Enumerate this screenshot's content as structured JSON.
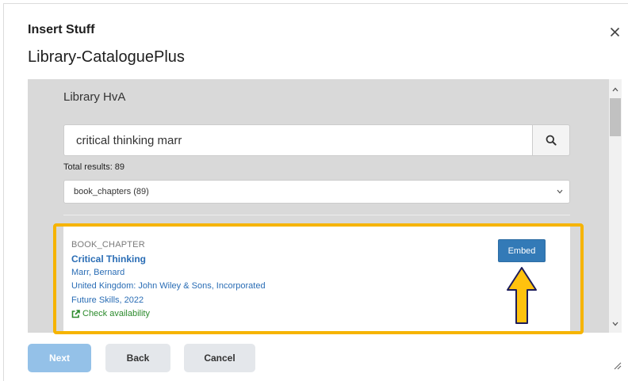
{
  "dialog": {
    "title": "Insert Stuff",
    "subtitle": "Library-CataloguePlus",
    "close_icon": "close-icon",
    "resize_icon": "resize-handle-icon"
  },
  "library": {
    "name": "Library HvA"
  },
  "search": {
    "value": "critical thinking marr",
    "button_icon": "search-icon"
  },
  "results": {
    "total": "Total results: 89"
  },
  "filter": {
    "selected": "book_chapters (89)",
    "icon": "chevron-down-icon"
  },
  "result": {
    "type": "BOOK_CHAPTER",
    "title": "Critical Thinking",
    "author": "Marr, Bernard",
    "publisher": "United Kingdom: John Wiley & Sons, Incorporated",
    "source": "Future Skills, 2022",
    "availability": "Check availability",
    "availability_icon": "external-link-icon",
    "embed_label": "Embed"
  },
  "footer": {
    "next": "Next",
    "back": "Back",
    "cancel": "Cancel"
  },
  "annotation": {
    "arrow_icon": "up-arrow-icon"
  },
  "colors": {
    "accent": "#337ab7",
    "link": "#2a6db5",
    "available": "#2b8a2b",
    "highlight": "#f6b400",
    "panel": "#d9d9d9",
    "arrow-fill": "#ffc20e",
    "arrow-stroke": "#1c1c5a",
    "next": "#94c1e8",
    "secondary": "#e4e7eb"
  }
}
